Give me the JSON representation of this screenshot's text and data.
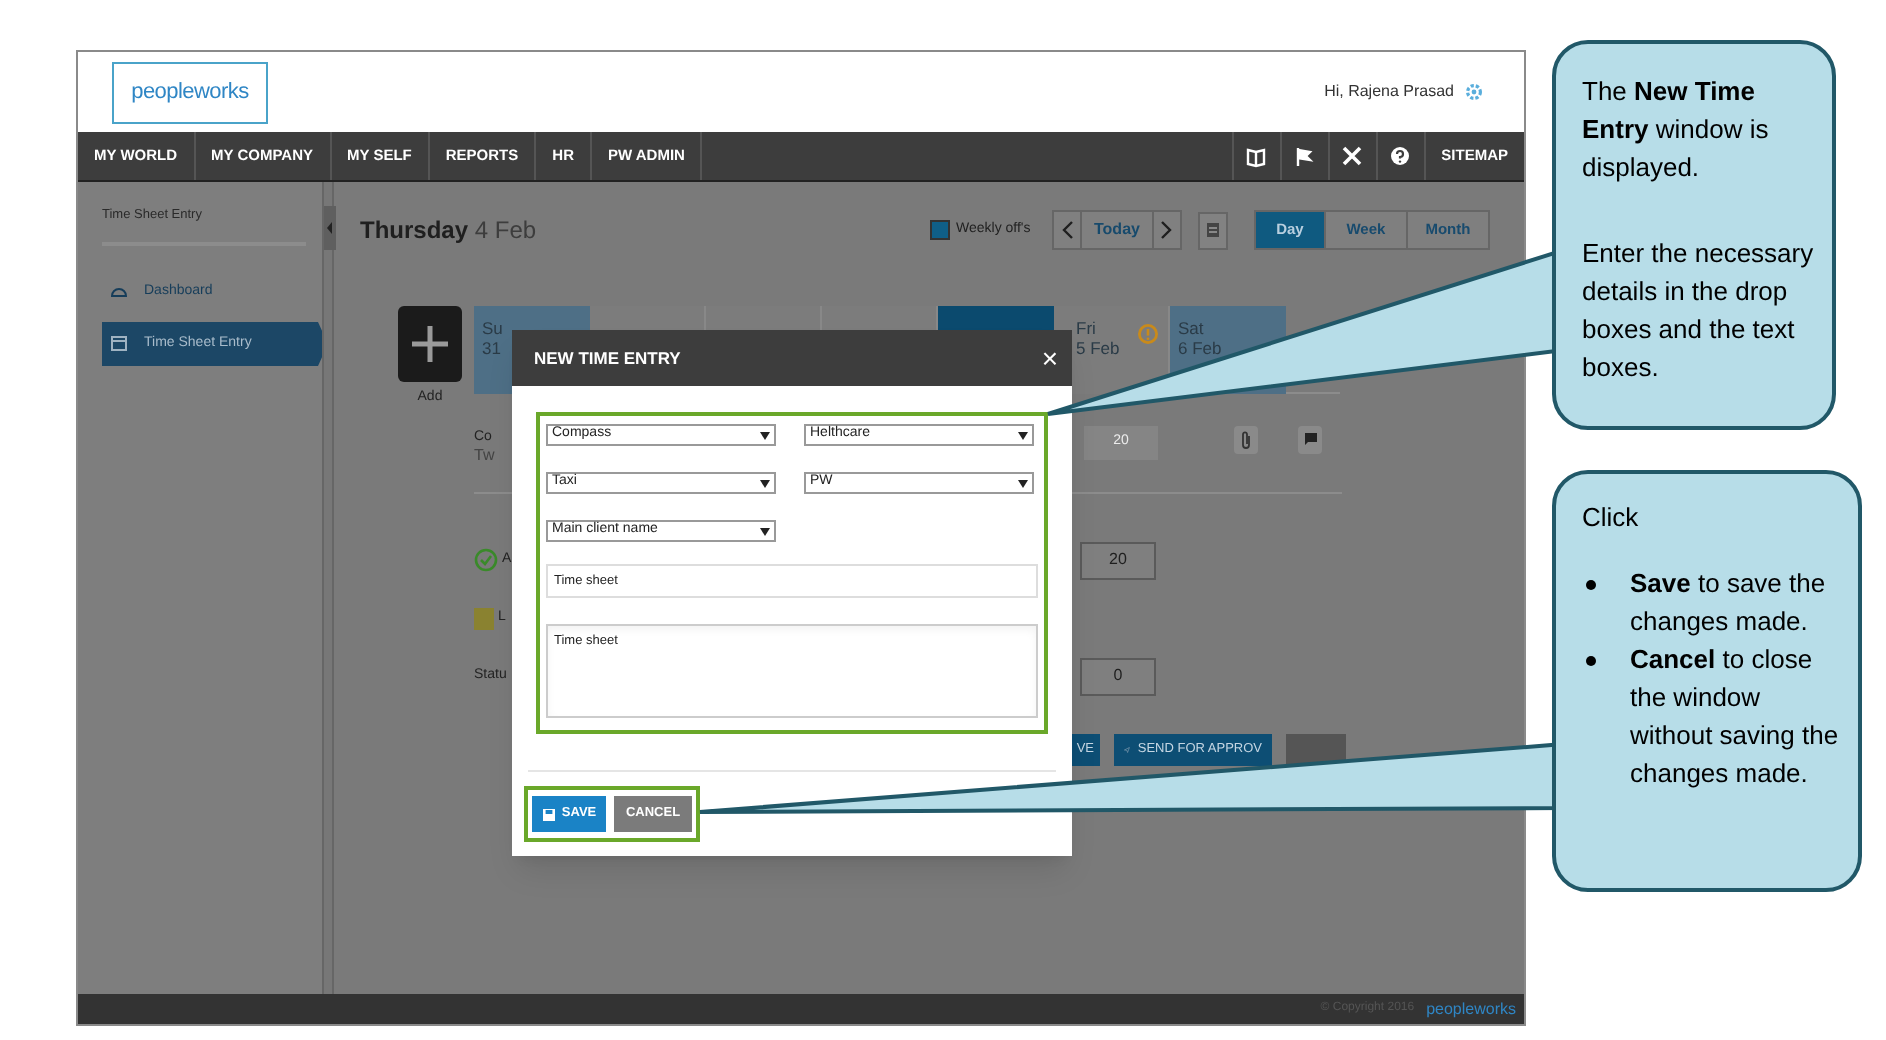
{
  "header": {
    "logo": "peopleworks",
    "greeting": "Hi, Rajena Prasad"
  },
  "nav": {
    "items": [
      {
        "label": "MY WORLD"
      },
      {
        "label": "MY COMPANY"
      },
      {
        "label": "MY SELF"
      },
      {
        "label": "REPORTS"
      },
      {
        "label": "HR"
      },
      {
        "label": "PW ADMIN"
      }
    ],
    "tools": [
      {
        "kind": "book"
      },
      {
        "kind": "flag"
      },
      {
        "kind": "tools"
      },
      {
        "kind": "help"
      }
    ],
    "sitemap": "SITEMAP"
  },
  "sidebar": {
    "title": "Time Sheet Entry",
    "items": [
      {
        "label": "Dashboard",
        "kind": "dashboard",
        "selected": false
      },
      {
        "label": "Time Sheet Entry",
        "kind": "calendar",
        "selected": true
      }
    ]
  },
  "toolbar": {
    "day_name": "Thursday",
    "date": "4 Feb",
    "legend": "Weekly off's",
    "today": "Today",
    "views": [
      {
        "label": "Day",
        "selected": true
      },
      {
        "label": "Week",
        "selected": false
      },
      {
        "label": "Month",
        "selected": false
      }
    ]
  },
  "add_label": "Add",
  "days": [
    {
      "kind": "weekly_off",
      "name": "Su",
      "date": "31"
    },
    {
      "kind": "plain"
    },
    {
      "kind": "plain"
    },
    {
      "kind": "plain"
    },
    {
      "kind": "current"
    },
    {
      "kind": "plain",
      "name": "Fri",
      "date": "5 Feb",
      "warning": true
    },
    {
      "kind": "weekly_off",
      "name": "Sat",
      "date": "6 Feb"
    }
  ],
  "entry": {
    "line_1": "Co",
    "line_2": "Tw",
    "hours": "20"
  },
  "summary": [
    {
      "kind": "approved",
      "label": "A",
      "value": "20"
    },
    {
      "kind": "leave",
      "label": "L"
    },
    {
      "kind": "status",
      "label": "Statu",
      "value": "0"
    }
  ],
  "actions": [
    {
      "kind": "save",
      "label": "VE"
    },
    {
      "kind": "send",
      "label": "SEND FOR APPROV"
    },
    {
      "kind": "plain"
    }
  ],
  "modal": {
    "title": "NEW TIME ENTRY",
    "close": "×",
    "selects": [
      {
        "value": "Compass"
      },
      {
        "value": "Helthcare"
      },
      {
        "value": "Taxi"
      },
      {
        "value": "PW"
      },
      {
        "value": "Main client name"
      }
    ],
    "input_value": "Time sheet",
    "textarea_value": "Time sheet",
    "buttons": [
      {
        "kind": "primary",
        "label": "SAVE"
      },
      {
        "kind": "secondary",
        "label": "CANCEL"
      }
    ]
  },
  "footer": {
    "copyright": "© Copyright 2016",
    "logo": "peopleworks"
  },
  "callouts": [
    {
      "paragraphs": [
        "The **New Time Entry** window is displayed.",
        "Enter the necessary details in the drop boxes and the text boxes."
      ]
    },
    {
      "intro": "Click",
      "bullets": [
        "**Save** to save the changes made.",
        "**Cancel** to close the window without saving the changes made."
      ]
    }
  ]
}
